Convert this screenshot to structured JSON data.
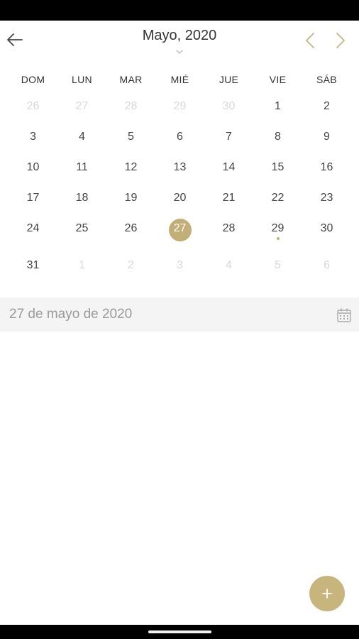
{
  "header": {
    "title": "Mayo, 2020",
    "back_icon": "arrow-left-icon",
    "dropdown_icon": "chevron-down-icon",
    "prev_icon": "chevron-left-icon",
    "next_icon": "chevron-right-icon",
    "accent_color": "#c2ae76"
  },
  "weekdays": [
    "DOM",
    "LUN",
    "MAR",
    "MIÉ",
    "JUE",
    "VIE",
    "SÁB"
  ],
  "calendar": {
    "weeks": [
      [
        "26",
        "27",
        "28",
        "29",
        "30",
        "1",
        "2"
      ],
      [
        "3",
        "4",
        "5",
        "6",
        "7",
        "8",
        "9"
      ],
      [
        "10",
        "11",
        "12",
        "13",
        "14",
        "15",
        "16"
      ],
      [
        "17",
        "18",
        "19",
        "20",
        "21",
        "22",
        "23"
      ],
      [
        "24",
        "25",
        "26",
        "27",
        "28",
        "29",
        "30"
      ],
      [
        "31",
        "1",
        "2",
        "3",
        "4",
        "5",
        "6"
      ]
    ],
    "selected_day": "27",
    "event_dot_day": "29",
    "selected_color": "#c2ae76",
    "other_month_color": "#d8d8d8"
  },
  "selected_date": {
    "label": "27 de mayo de 2020",
    "calendar_icon": "calendar-icon"
  },
  "fab": {
    "icon": "plus-icon",
    "color": "#c8b47d"
  }
}
